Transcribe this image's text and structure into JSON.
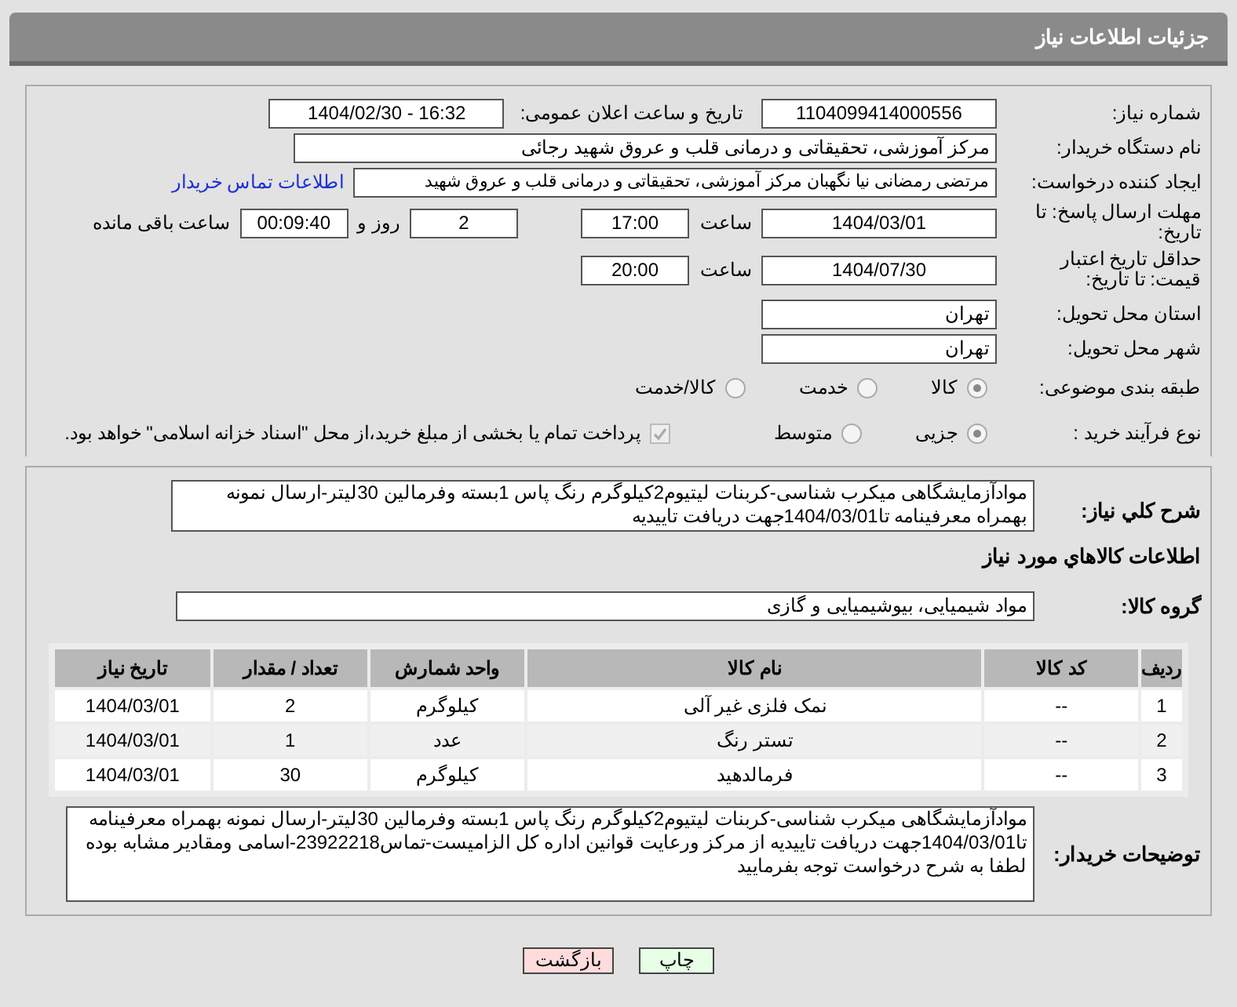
{
  "header": {
    "title": "جزئیات اطلاعات نیاز"
  },
  "fields": {
    "need_number": {
      "label": "شماره نیاز:",
      "value": "1104099414000556"
    },
    "announce": {
      "label": "تاریخ و ساعت اعلان عمومی:",
      "value": "1404/02/30 - 16:32"
    },
    "buyer": {
      "label": "نام دستگاه خریدار:",
      "value": "مرکز آموزشی، تحقیقاتی و درمانی قلب و عروق شهید رجائی"
    },
    "creator": {
      "label": "ایجاد کننده درخواست:",
      "value": "مرتضی رمضانی نیا نگهبان مرکز آموزشی، تحقیقاتی و درمانی قلب و عروق شهید",
      "link": "اطلاعات تماس خریدار"
    },
    "deadline": {
      "label": "مهلت ارسال پاسخ: تا تاریخ:",
      "date": "1404/03/01",
      "time_label": "ساعت",
      "time": "17:00",
      "days": "2",
      "days_label": "روز و",
      "remaining": "00:09:40",
      "remaining_label": "ساعت باقی مانده"
    },
    "validity": {
      "label": "حداقل تاریخ اعتبار قیمت: تا تاریخ:",
      "date": "1404/07/30",
      "time_label": "ساعت",
      "time": "20:00"
    },
    "province": {
      "label": "استان محل تحویل:",
      "value": "تهران"
    },
    "city": {
      "label": "شهر محل تحویل:",
      "value": "تهران"
    }
  },
  "category": {
    "label": "طبقه بندی موضوعی:",
    "options": [
      {
        "label": "کالا",
        "selected": true
      },
      {
        "label": "خدمت",
        "selected": false
      },
      {
        "label": "کالا/خدمت",
        "selected": false
      }
    ]
  },
  "process": {
    "label": "نوع فرآیند خرید :",
    "options": [
      {
        "label": "جزیی",
        "selected": true
      },
      {
        "label": "متوسط",
        "selected": false
      }
    ],
    "treasury": {
      "label": "پرداخت تمام یا بخشی از مبلغ خرید،از محل \"اسناد خزانه اسلامی\" خواهد بود.",
      "checked": true,
      "disabled": true
    }
  },
  "description": {
    "label": "شرح کلي نياز:",
    "value": "موادآزمایشگاهی میکرب شناسی-کربنات لیتیوم2کیلوگرم رنگ پاس 1بسته وفرمالین 30لیتر-ارسال نمونه بهمراه معرفینامه تا1404/03/01جهت دریافت تاییدیه"
  },
  "goods_title": "اطلاعات کالاهاي مورد نياز",
  "goods_group": {
    "label": "گروه کالا:",
    "value": "مواد شیمیایی، بیوشیمیایی و  گازی"
  },
  "table": {
    "columns": [
      "ردیف",
      "کد کالا",
      "نام کالا",
      "واحد شمارش",
      "تعداد / مقدار",
      "تاریخ نیاز"
    ],
    "rows": [
      [
        "1",
        "--",
        "نمک فلزی غیر آلی",
        "کیلوگرم",
        "2",
        "1404/03/01"
      ],
      [
        "2",
        "--",
        "تستر رنگ",
        "عدد",
        "1",
        "1404/03/01"
      ],
      [
        "3",
        "--",
        "فرمالدهید",
        "کیلوگرم",
        "30",
        "1404/03/01"
      ]
    ]
  },
  "buyer_notes": {
    "label": "توضیحات خریدار:",
    "value": "موادآزمایشگاهی میکرب شناسی-کربنات لیتیوم2کیلوگرم رنگ پاس 1بسته وفرمالین 30لیتر-ارسال نمونه بهمراه معرفینامه تا1404/03/01جهت دریافت تاییدیه از مرکز ورعایت قوانین اداره کل الزامیست-تماس23922218-اسامی ومقادیر مشابه بوده لطفا به شرح درخواست توجه بفرمایید"
  },
  "buttons": [
    {
      "label": "چاپ",
      "kind": "print"
    },
    {
      "label": "بازگشت",
      "kind": "back"
    }
  ]
}
